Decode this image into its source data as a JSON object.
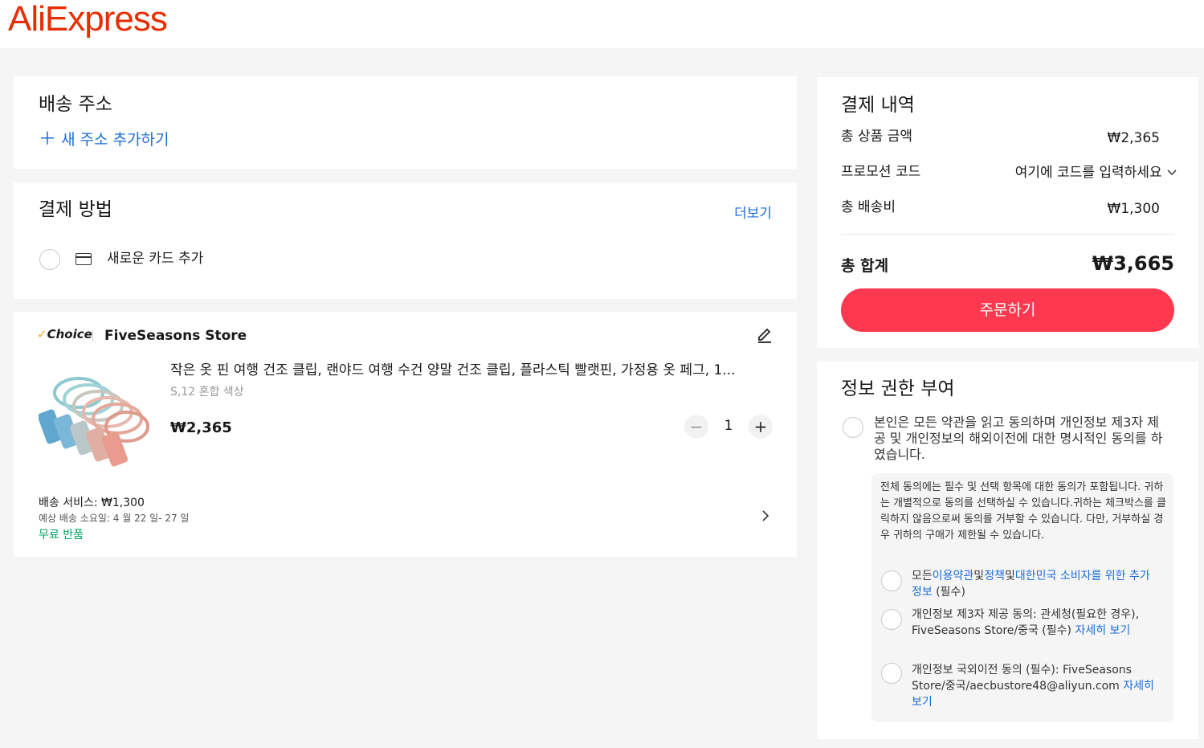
{
  "header": {
    "logo": "AliExpress"
  },
  "shipping": {
    "title": "배송 주소",
    "add_address": "새 주소 추가하기"
  },
  "payment": {
    "title": "결제 방법",
    "more": "더보기",
    "add_card": "새로운 카드 추가"
  },
  "order": {
    "badge": "Choice",
    "store": "FiveSeasons Store",
    "product_title": "작은 옷 핀 여행 건조 클립, 랜야드 여행 수건 양말 건조 클립, 플라스틱 빨랫핀, 가정용 옷 페그, 1...",
    "variant": "S,12 혼합 색상",
    "price": "₩2,365",
    "quantity": "1",
    "shipping_service": "배송 서비스: ₩1,300",
    "eta": "예상 배송 소요일: 4 월 22 일- 27 일",
    "free_return": "무료 반품"
  },
  "summary": {
    "title": "결제 내역",
    "subtotal_label": "총 상품 금액",
    "subtotal": "₩2,365",
    "promo_label": "프로모션 코드",
    "promo_placeholder": "여기에 코드를 입력하세요",
    "shipping_label": "총 배송비",
    "shipping": "₩1,300",
    "total_label": "총 합계",
    "total": "₩3,665",
    "order_button": "주문하기"
  },
  "consent": {
    "title": "정보 권한 부여",
    "all": "본인은 모든 약관을 읽고 동의하며 개인정보 제3자 제공 및 개인정보의 해외이전에 대한 명시적인 동의를 하였습니다.",
    "notice": "전체 동의에는 필수 및 선택 항목에 대한 동의가 포함됩니다. 귀하는 개별적으로 동의를 선택하실 수 있습니다.귀하는 체크박스를 클릭하지 않음으로써 동의를 거부할 수 있습니다. 다만, 거부하실 경우 귀하의 구매가 제한될 수 있습니다.",
    "item1_pre": "모든",
    "item1_link1": "이용약관",
    "item1_mid": "및",
    "item1_link2": "정책",
    "item1_mid2": "및",
    "item1_link3": "대한민국 소비자를 위한 추가 정보",
    "item1_post": " (필수)",
    "item2_text": "개인정보 제3자 제공 동의: 관세청(필요한 경우), FiveSeasons Store/중국 (필수) ",
    "item2_link": "자세히 보기",
    "item3_text": "개인정보 국외이전 동의 (필수): FiveSeasons Store/중국/aecbustore48@aliyun.com ",
    "item3_link": "자세히 보기"
  },
  "colors": {
    "brand": "#e62e04",
    "cta": "#fd384f",
    "link": "#1a6ddb",
    "free_return": "#00a15d"
  }
}
